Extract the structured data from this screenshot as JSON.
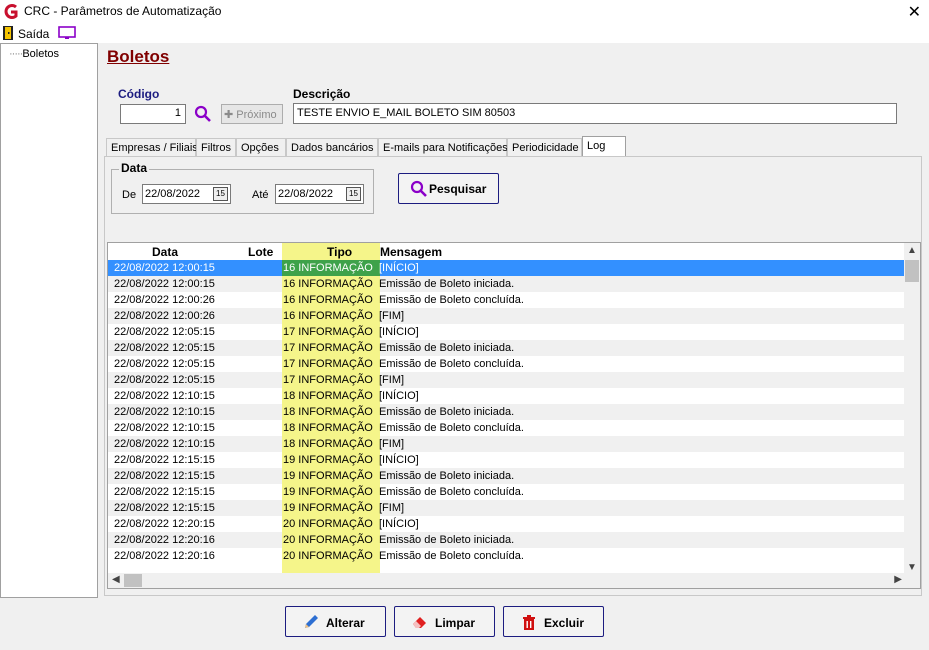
{
  "window": {
    "title": "CRC - Parâmetros de Automatização"
  },
  "menu": {
    "exit_label": "Saída"
  },
  "tree": {
    "items": [
      {
        "label": "Boletos"
      }
    ]
  },
  "page": {
    "title": "Boletos"
  },
  "form": {
    "codigo_label": "Código",
    "codigo_value": "1",
    "proximo_label": "Próximo",
    "descricao_label": "Descrição",
    "descricao_value": "TESTE ENVIO  E_MAIL BOLETO SIM 80503"
  },
  "tabs": [
    {
      "label": "Empresas / Filiais",
      "active": false
    },
    {
      "label": "Filtros",
      "active": false
    },
    {
      "label": "Opções",
      "active": false
    },
    {
      "label": "Dados bancários",
      "active": false
    },
    {
      "label": "E-mails para Notificações",
      "active": false
    },
    {
      "label": "Periodicidade",
      "active": false
    },
    {
      "label": "Log",
      "active": true
    }
  ],
  "filter": {
    "group_title": "Data",
    "de_label": "De",
    "de_value": "22/08/2022",
    "ate_label": "Até",
    "ate_value": "22/08/2022",
    "calendar_glyph": "15",
    "search_label": "Pesquisar"
  },
  "grid": {
    "columns": [
      "Data",
      "Lote",
      "Tipo",
      "Mensagem"
    ],
    "rows": [
      [
        "22/08/2022 12:00:15",
        "",
        "16 INFORMAÇÃO",
        "[INÍCIO]"
      ],
      [
        "22/08/2022 12:00:15",
        "",
        "16 INFORMAÇÃO",
        "Emissão de Boleto iniciada."
      ],
      [
        "22/08/2022 12:00:26",
        "",
        "16 INFORMAÇÃO",
        "Emissão de Boleto concluída."
      ],
      [
        "22/08/2022 12:00:26",
        "",
        "16 INFORMAÇÃO",
        "[FIM]"
      ],
      [
        "22/08/2022 12:05:15",
        "",
        "17 INFORMAÇÃO",
        "[INÍCIO]"
      ],
      [
        "22/08/2022 12:05:15",
        "",
        "17 INFORMAÇÃO",
        "Emissão de Boleto iniciada."
      ],
      [
        "22/08/2022 12:05:15",
        "",
        "17 INFORMAÇÃO",
        "Emissão de Boleto concluída."
      ],
      [
        "22/08/2022 12:05:15",
        "",
        "17 INFORMAÇÃO",
        "[FIM]"
      ],
      [
        "22/08/2022 12:10:15",
        "",
        "18 INFORMAÇÃO",
        "[INÍCIO]"
      ],
      [
        "22/08/2022 12:10:15",
        "",
        "18 INFORMAÇÃO",
        "Emissão de Boleto iniciada."
      ],
      [
        "22/08/2022 12:10:15",
        "",
        "18 INFORMAÇÃO",
        "Emissão de Boleto concluída."
      ],
      [
        "22/08/2022 12:10:15",
        "",
        "18 INFORMAÇÃO",
        "[FIM]"
      ],
      [
        "22/08/2022 12:15:15",
        "",
        "19 INFORMAÇÃO",
        "[INÍCIO]"
      ],
      [
        "22/08/2022 12:15:15",
        "",
        "19 INFORMAÇÃO",
        "Emissão de Boleto iniciada."
      ],
      [
        "22/08/2022 12:15:15",
        "",
        "19 INFORMAÇÃO",
        "Emissão de Boleto concluída."
      ],
      [
        "22/08/2022 12:15:15",
        "",
        "19 INFORMAÇÃO",
        "[FIM]"
      ],
      [
        "22/08/2022 12:20:15",
        "",
        "20 INFORMAÇÃO",
        "[INÍCIO]"
      ],
      [
        "22/08/2022 12:20:16",
        "",
        "20 INFORMAÇÃO",
        "Emissão de Boleto iniciada."
      ],
      [
        "22/08/2022 12:20:16",
        "",
        "20 INFORMAÇÃO",
        "Emissão de Boleto concluída."
      ]
    ],
    "selected_row": 0
  },
  "actions": {
    "alterar_label": "Alterar",
    "limpar_label": "Limpar",
    "excluir_label": "Excluir"
  },
  "colors": {
    "title_accent": "#800000",
    "label_blue": "#1c1c80",
    "tipo_highlight": "#f5f58a",
    "selected_row": "#3390ff",
    "selected_tipo": "#3ea24a"
  },
  "icons": [
    "app-logo-icon",
    "exit-icon",
    "screen-icon",
    "search-icon",
    "calendar-icon",
    "pencil-icon",
    "eraser-icon",
    "trash-icon",
    "close-icon"
  ]
}
